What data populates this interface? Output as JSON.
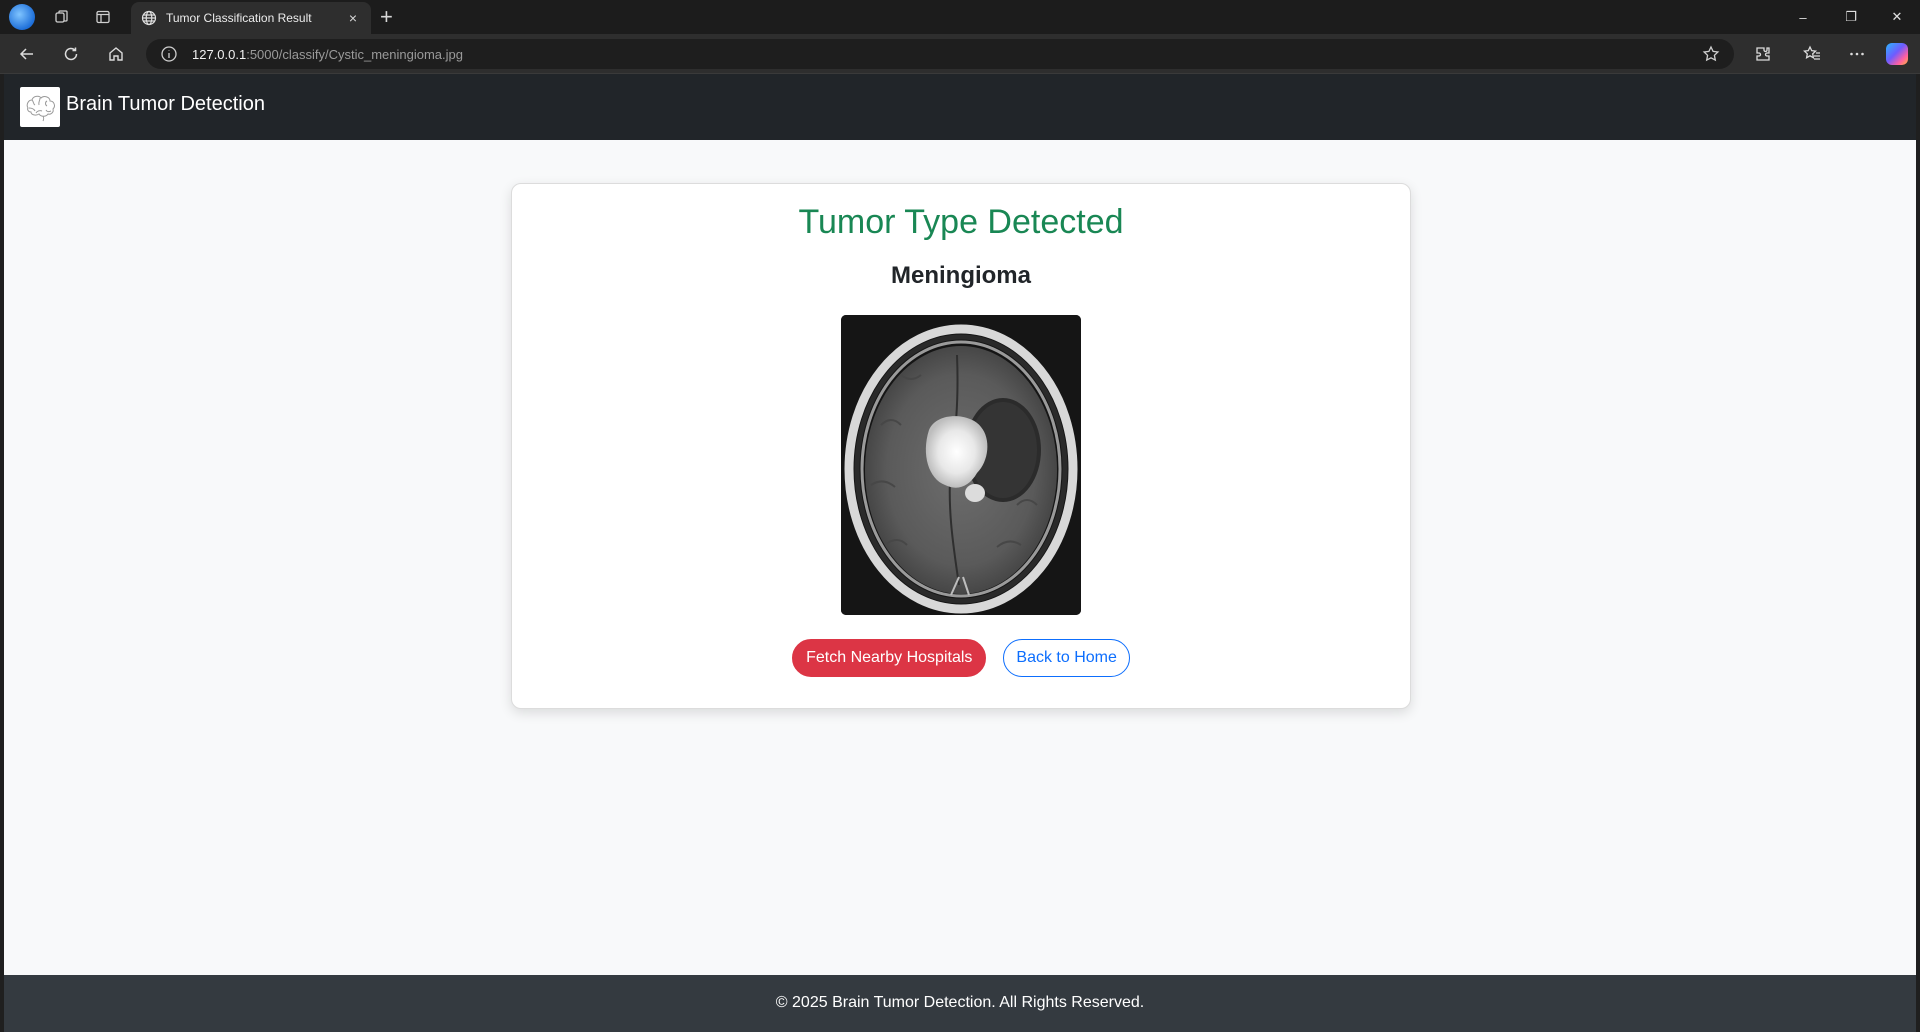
{
  "browser": {
    "tab_title": "Tumor Classification Result",
    "tab_close": "×",
    "new_tab": "+",
    "url_host": "127.0.0.1",
    "url_path": ":5000/classify/Cystic_meningioma.jpg",
    "window_controls": {
      "minimize": "–",
      "restore": "❐",
      "close": "✕"
    }
  },
  "navbar": {
    "brand": "Brain Tumor Detection",
    "logo_icon": "brain-icon"
  },
  "result": {
    "heading": "Tumor Type Detected",
    "tumor_type": "Meningioma",
    "image_alt": "brain-mri-scan",
    "fetch_hospitals_label": "Fetch Nearby Hospitals",
    "back_home_label": "Back to Home"
  },
  "footer": {
    "text": "© 2025 Brain Tumor Detection. All Rights Reserved."
  },
  "colors": {
    "navbar_bg": "#212529",
    "heading_green": "#198754",
    "danger": "#dc3545",
    "primary": "#0d6efd",
    "footer_bg": "#343a40",
    "page_bg": "#f8f9fa"
  }
}
